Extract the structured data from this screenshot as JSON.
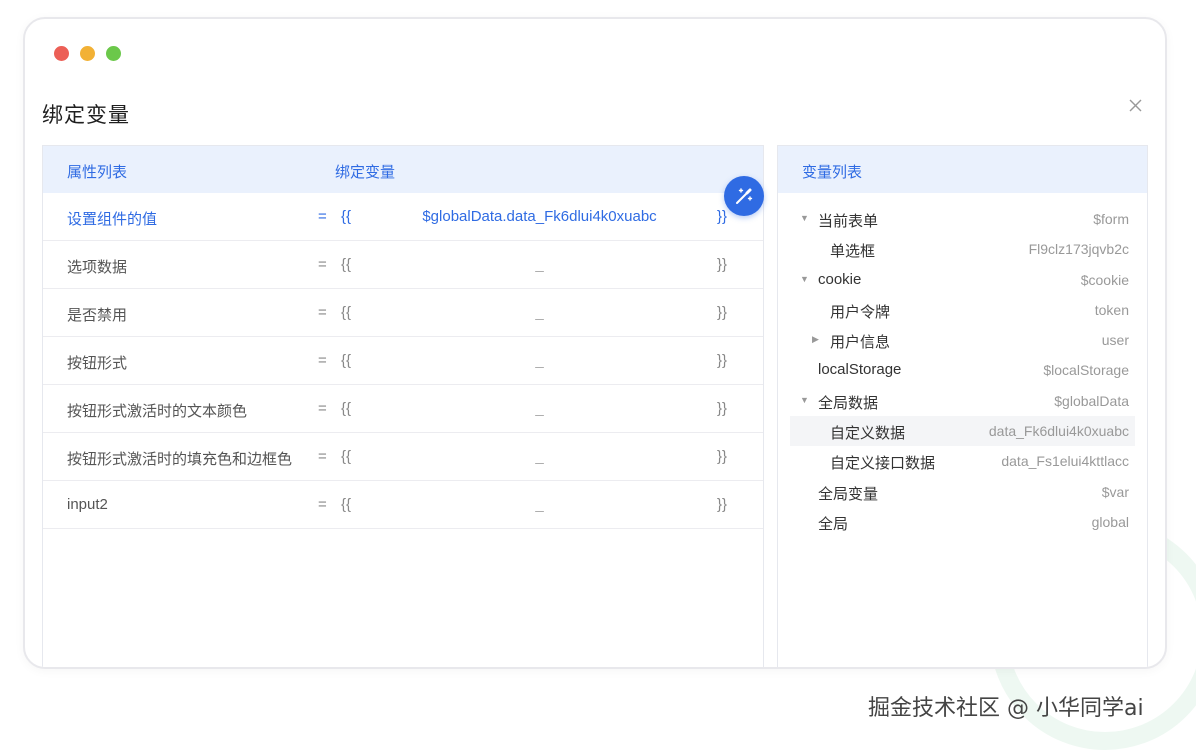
{
  "dialog": {
    "title": "绑定变量"
  },
  "left_table": {
    "headers": {
      "property": "属性列表",
      "binding": "绑定变量"
    },
    "rows": [
      {
        "property": "设置组件的值",
        "eq": "=",
        "open": "{{",
        "value": "$globalData.data_Fk6dlui4k0xuabc",
        "close": "}}",
        "active": true
      },
      {
        "property": "选项数据",
        "eq": "=",
        "open": "{{",
        "value": "_",
        "close": "}}"
      },
      {
        "property": "是否禁用",
        "eq": "=",
        "open": "{{",
        "value": "_",
        "close": "}}"
      },
      {
        "property": "按钮形式",
        "eq": "=",
        "open": "{{",
        "value": "_",
        "close": "}}"
      },
      {
        "property": "按钮形式激活时的文本颜色",
        "eq": "=",
        "open": "{{",
        "value": "_",
        "close": "}}"
      },
      {
        "property": "按钮形式激活时的填充色和边框色",
        "eq": "=",
        "open": "{{",
        "value": "_",
        "close": "}}"
      },
      {
        "property": "input2",
        "eq": "=",
        "open": "{{",
        "value": "_",
        "close": "}}"
      }
    ]
  },
  "right_panel": {
    "header": "变量列表",
    "nodes": [
      {
        "label": "当前表单",
        "key": "$form",
        "caret": "down",
        "level": 0
      },
      {
        "label": "单选框",
        "key": "Fl9clz173jqvb2c",
        "level": 1
      },
      {
        "label": "cookie",
        "key": "$cookie",
        "caret": "down",
        "level": 0
      },
      {
        "label": "用户令牌",
        "key": "token",
        "level": 1
      },
      {
        "label": "用户信息",
        "key": "user",
        "caret": "right",
        "level": 1
      },
      {
        "label": "localStorage",
        "key": "$localStorage",
        "level": 0
      },
      {
        "label": "全局数据",
        "key": "$globalData",
        "caret": "down",
        "level": 0
      },
      {
        "label": "自定义数据",
        "key": "data_Fk6dlui4k0xuabc",
        "level": 1,
        "selected": true
      },
      {
        "label": "自定义接口数据",
        "key": "data_Fs1elui4kttlacc",
        "level": 1
      },
      {
        "label": "全局变量",
        "key": "$var",
        "level": 0
      },
      {
        "label": "全局",
        "key": "global",
        "level": 0
      }
    ]
  },
  "watermark": "掘金技术社区 @ 小华同学ai",
  "colors": {
    "accent": "#2f6be3",
    "header_bg": "#eaf1fd",
    "traffic_red": "#ec5f56",
    "traffic_yellow": "#f2b135",
    "traffic_green": "#6bc84a"
  },
  "icons": {
    "close": "close-icon",
    "magic": "magic-wand-icon"
  }
}
